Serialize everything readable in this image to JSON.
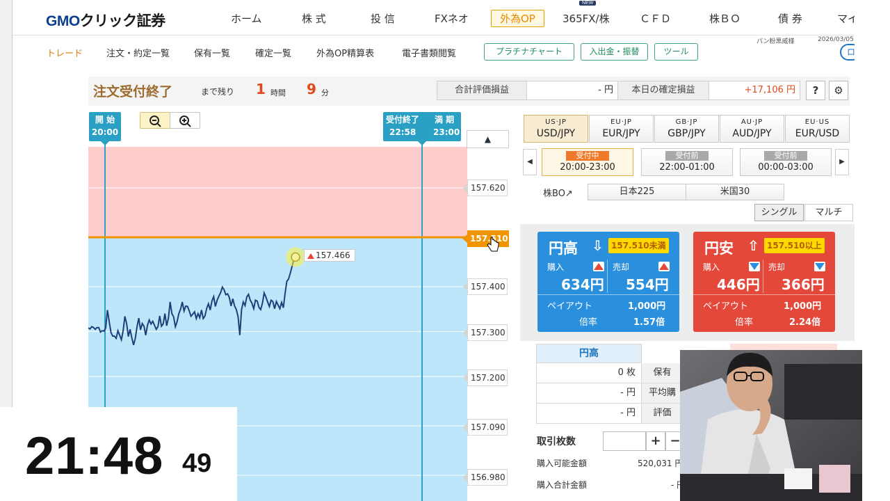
{
  "brand": {
    "main": "GMO",
    "sub": "クリック証券"
  },
  "nav": {
    "items": [
      "ホーム",
      "株 式",
      "投 信",
      "FXネオ",
      "外為OP",
      "365FX/株",
      "ＣＦＤ",
      "株ＢＯ",
      "債 券",
      "マイ"
    ],
    "new_badge": "NEW"
  },
  "subnav": {
    "items": [
      "トレード",
      "注文・約定一覧",
      "保有一覧",
      "確定一覧",
      "外為OP精算表",
      "電子書類閲覧"
    ],
    "buttons": [
      "プラチナチャート",
      "入出金・振替",
      "ツール"
    ],
    "account": "パン粉黒威様",
    "date": "2026/03/05",
    "logout": "ロ"
  },
  "order": {
    "title": "注文受付終了",
    "remain_label": "まで残り",
    "hours": "1",
    "hours_label": "時間",
    "minutes": "9",
    "minutes_label": "分",
    "total_label": "合計評価損益",
    "total_value": "- 円",
    "today_label": "本日の確定損益",
    "today_value": "+17,106 円",
    "help_icon": "?",
    "settings_icon": "gear-icon"
  },
  "chart": {
    "start_marker": {
      "label": "開 始",
      "time": "20:00"
    },
    "end_marker": {
      "label1": "受付終了",
      "label2": "満 期",
      "time1": "22:58",
      "time2": "23:00"
    },
    "current_price": "157.466",
    "strike_price": "157.510",
    "ticks": [
      "157.620",
      "157.400",
      "157.300",
      "157.200",
      "157.090",
      "156.980"
    ],
    "up_arrow": "▲",
    "colors": {
      "upper_zone": "#ffcccc",
      "lower_zone": "#bde6fa",
      "line": "#1f3f78",
      "strike": "#f29400",
      "marker": "#2aa0c4"
    }
  },
  "chart_data": {
    "type": "line",
    "xlabel": "",
    "ylabel": "",
    "ylim": [
      156.94,
      157.76
    ],
    "xlim": [
      "19:50",
      "23:05"
    ],
    "series": [
      {
        "values": [
          157.308,
          157.306,
          157.311,
          157.309,
          157.305,
          157.309,
          157.309,
          157.299,
          157.302,
          157.301,
          157.308,
          157.348,
          157.322,
          157.298,
          157.29,
          157.29,
          157.285,
          157.302,
          157.292,
          157.282,
          157.302,
          157.334,
          157.318,
          157.289,
          157.305,
          157.286,
          157.27,
          157.285,
          157.311,
          157.33,
          157.304,
          157.318,
          157.312,
          157.292,
          157.314,
          157.326,
          157.317,
          157.323,
          157.314,
          157.305,
          157.311,
          157.335,
          157.312,
          157.317,
          157.34,
          157.313,
          157.33,
          157.366,
          157.34,
          157.333,
          157.311,
          157.322,
          157.34,
          157.35,
          157.366,
          157.346,
          157.357,
          157.356,
          157.346,
          157.334,
          157.339,
          157.344,
          157.329,
          157.34,
          157.331,
          157.348,
          157.329,
          157.335,
          157.352,
          157.362,
          157.348,
          157.368,
          157.378,
          157.356,
          157.37,
          157.379,
          157.387,
          157.399,
          157.393,
          157.382,
          157.384,
          157.376,
          157.357,
          157.373,
          157.357,
          157.349,
          157.333,
          157.292,
          157.349,
          157.366,
          157.358,
          157.377,
          157.383,
          157.37,
          157.363,
          157.351,
          157.37,
          157.368,
          157.354,
          157.349,
          157.363,
          157.386,
          157.377,
          157.366,
          157.356,
          157.37,
          157.367,
          157.351,
          157.367,
          157.359,
          157.351,
          157.365,
          157.353,
          157.385,
          157.412,
          157.417,
          157.43,
          157.445,
          157.46,
          157.466
        ]
      }
    ]
  },
  "pairs": [
    {
      "flag": "US·JP",
      "name": "USD/JPY"
    },
    {
      "flag": "EU·JP",
      "name": "EUR/JPY"
    },
    {
      "flag": "GB·JP",
      "name": "GBP/JPY"
    },
    {
      "flag": "AU·JP",
      "name": "AUD/JPY"
    },
    {
      "flag": "EU·US",
      "name": "EUR/USD"
    }
  ],
  "slots": [
    {
      "status": "受付中",
      "time": "20:00-23:00"
    },
    {
      "status": "受付前",
      "time": "22:00-01:00"
    },
    {
      "status": "受付前",
      "time": "00:00-03:00"
    }
  ],
  "kabubo": {
    "label": "株BO↗",
    "items": [
      "日本225",
      "米国30"
    ]
  },
  "mode": {
    "single": "シングル",
    "multi": "マルチ"
  },
  "bo_up": {
    "title": "円高",
    "tag": "157.510未満",
    "buy_label": "購入",
    "sell_label": "売却",
    "buy": "634円",
    "sell": "554円",
    "payout_label": "ペイアウト",
    "payout": "1,000円",
    "rate_label": "倍率",
    "rate": "1.57倍"
  },
  "bo_dn": {
    "title": "円安",
    "tag": "157.510以上",
    "buy_label": "購入",
    "sell_label": "売却",
    "buy": "446円",
    "sell": "366円",
    "payout_label": "ペイアウト",
    "payout": "1,000円",
    "rate_label": "倍率",
    "rate": "2.24倍"
  },
  "position": {
    "head": "円高",
    "count": "0 枚",
    "count_label": "保有",
    "avg": "- 円",
    "avg_label": "平均購",
    "eval": "- 円",
    "eval_label": "評価"
  },
  "trade": {
    "qty_label": "取引枚数",
    "plus": "+",
    "minus": "−",
    "buyable_label": "購入可能金額",
    "buyable": "520,031 円",
    "total_label": "購入合計金額",
    "total": "- 円"
  },
  "clock": {
    "main": "21:48",
    "sec": "49"
  }
}
